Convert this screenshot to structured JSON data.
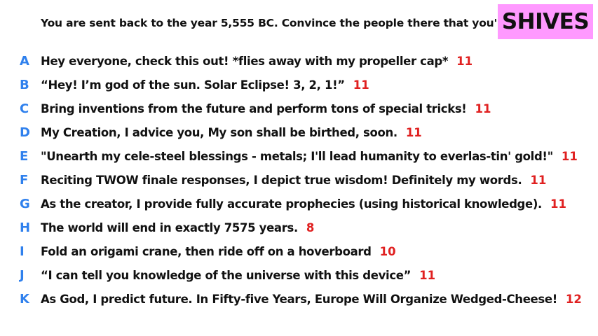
{
  "prompt": "You are sent back to the year 5,555 BC. Convince the people there that you're a god.",
  "badge": "SHIVES",
  "colors": {
    "letter": "#2f80ed",
    "count": "#e02020",
    "badge_bg": "#ff99ff"
  },
  "responses": [
    {
      "letter": "A",
      "text": "Hey everyone, check this out! *flies away with my propeller cap*",
      "count": "11"
    },
    {
      "letter": "B",
      "text": "“Hey! I’m god of the sun. Solar Eclipse! 3, 2, 1!”",
      "count": "11"
    },
    {
      "letter": "C",
      "text": "Bring inventions from the future and perform tons of special tricks!",
      "count": "11"
    },
    {
      "letter": "D",
      "text": "My Creation, I advice you, My son shall be birthed, soon.",
      "count": "11"
    },
    {
      "letter": "E",
      "text": "\"Unearth my cele-steel blessings - metals; I'll lead humanity to everlas-tin' gold!\"",
      "count": "11"
    },
    {
      "letter": "F",
      "text": "Reciting TWOW finale responses, I depict true wisdom! Definitely my words.",
      "count": "11"
    },
    {
      "letter": "G",
      "text": "As the creator, I provide fully accurate prophecies (using historical knowledge).",
      "count": "11"
    },
    {
      "letter": "H",
      "text": "The world will end in exactly 7575 years.",
      "count": "8"
    },
    {
      "letter": "I",
      "text": "Fold an origami crane, then ride off on a hoverboard",
      "count": "10"
    },
    {
      "letter": "J",
      "text": "“I can tell you knowledge of the universe with this device”",
      "count": "11"
    },
    {
      "letter": "K",
      "text": "As God, I predict future. In Fifty-five Years, Europe Will Organize Wedged-Cheese!",
      "count": "12"
    }
  ]
}
